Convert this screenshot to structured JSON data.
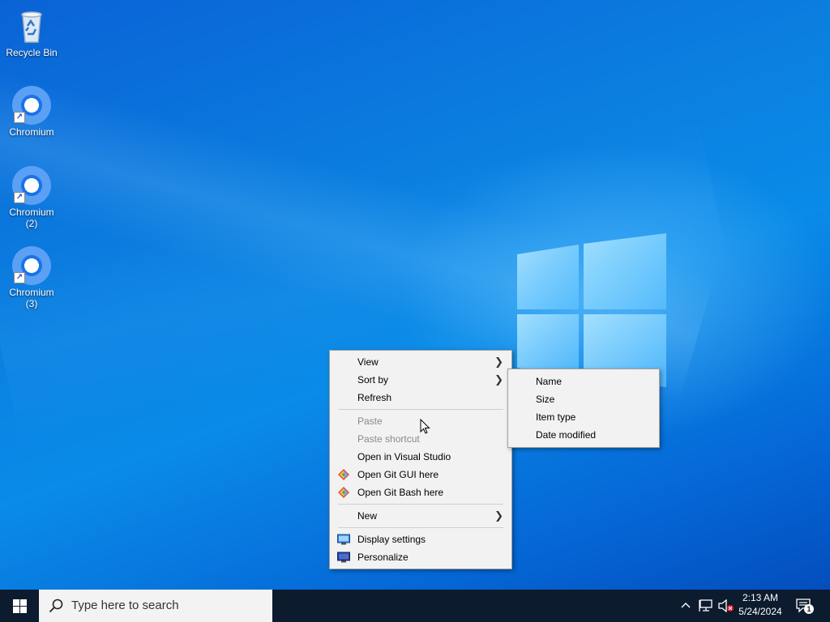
{
  "desktop": {
    "icons": [
      {
        "label": "Recycle Bin"
      },
      {
        "label": "Chromium"
      },
      {
        "label": "Chromium (2)"
      },
      {
        "label": "Chromium (3)"
      }
    ]
  },
  "context_menu": {
    "items": [
      {
        "label": "View",
        "submenu": true
      },
      {
        "label": "Sort by",
        "submenu": true
      },
      {
        "label": "Refresh"
      },
      {
        "label": "Paste",
        "disabled": true
      },
      {
        "label": "Paste shortcut",
        "disabled": true
      },
      {
        "label": "Open in Visual Studio"
      },
      {
        "label": "Open Git GUI here",
        "icon": "git-icon"
      },
      {
        "label": "Open Git Bash here",
        "icon": "git-icon"
      },
      {
        "label": "New",
        "submenu": true
      },
      {
        "label": "Display settings",
        "icon": "display-icon"
      },
      {
        "label": "Personalize",
        "icon": "personalize-icon"
      }
    ]
  },
  "sort_submenu": {
    "items": [
      {
        "label": "Name"
      },
      {
        "label": "Size"
      },
      {
        "label": "Item type"
      },
      {
        "label": "Date modified"
      }
    ]
  },
  "taskbar": {
    "search_placeholder": "Type here to search",
    "time": "2:13 AM",
    "date": "5/24/2024",
    "notification_count": "1"
  }
}
